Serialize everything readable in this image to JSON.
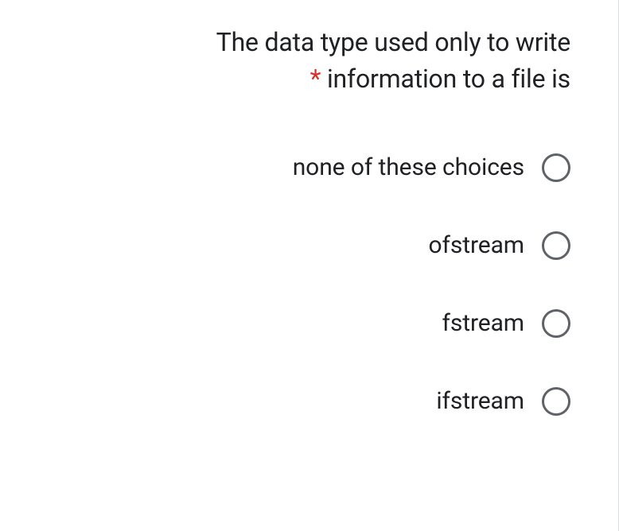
{
  "question": {
    "text_line1": "The data type used only to write",
    "text_line2": "information to a file is",
    "required_marker": "*"
  },
  "options": [
    {
      "label": "none of these choices"
    },
    {
      "label": "ofstream"
    },
    {
      "label": "fstream"
    },
    {
      "label": "ifstream"
    }
  ]
}
